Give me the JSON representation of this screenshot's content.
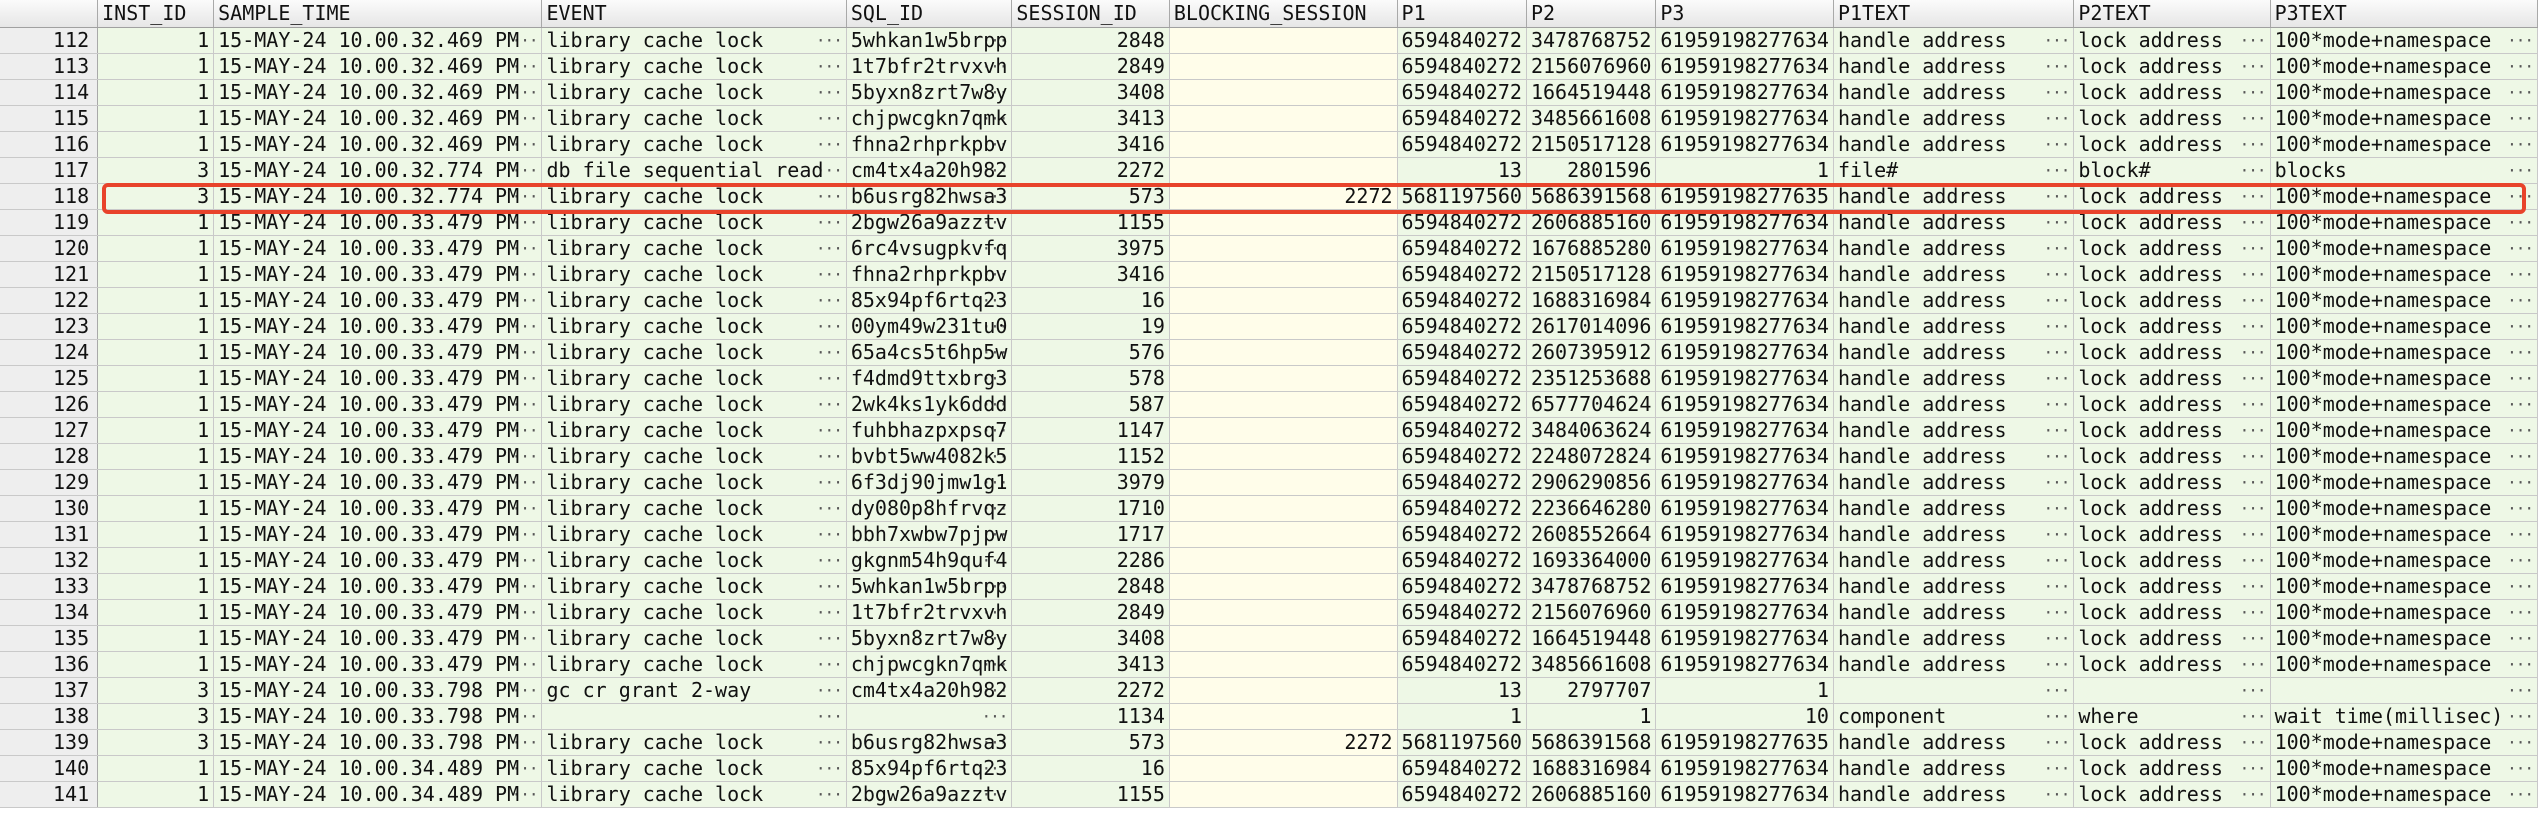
{
  "grid": {
    "columns": [
      {
        "key": "rownum",
        "label": ""
      },
      {
        "key": "inst_id",
        "label": "INST_ID"
      },
      {
        "key": "sample_time",
        "label": "SAMPLE_TIME"
      },
      {
        "key": "event",
        "label": "EVENT"
      },
      {
        "key": "sql_id",
        "label": "SQL_ID"
      },
      {
        "key": "session_id",
        "label": "SESSION_ID"
      },
      {
        "key": "blocking_session",
        "label": "BLOCKING_SESSION"
      },
      {
        "key": "p1",
        "label": "P1"
      },
      {
        "key": "p2",
        "label": "P2"
      },
      {
        "key": "p3",
        "label": "P3"
      },
      {
        "key": "p1text",
        "label": "P1TEXT"
      },
      {
        "key": "p2text",
        "label": "P2TEXT"
      },
      {
        "key": "p3text",
        "label": "P3TEXT"
      }
    ],
    "ellipsis_glyph": "···",
    "highlighted_row": "118",
    "rows": [
      [
        "112",
        "1",
        "15-MAY-24 10.00.32.469 PM",
        "library cache lock",
        "5whkan1w5brpp",
        "2848",
        "",
        "6594840272",
        "3478768752",
        "61959198277634",
        "handle address",
        "lock address",
        "100*mode+namespace"
      ],
      [
        "113",
        "1",
        "15-MAY-24 10.00.32.469 PM",
        "library cache lock",
        "1t7bfr2trvxvh",
        "2849",
        "",
        "6594840272",
        "2156076960",
        "61959198277634",
        "handle address",
        "lock address",
        "100*mode+namespace"
      ],
      [
        "114",
        "1",
        "15-MAY-24 10.00.32.469 PM",
        "library cache lock",
        "5byxn8zrt7w8y",
        "3408",
        "",
        "6594840272",
        "1664519448",
        "61959198277634",
        "handle address",
        "lock address",
        "100*mode+namespace"
      ],
      [
        "115",
        "1",
        "15-MAY-24 10.00.32.469 PM",
        "library cache lock",
        "chjpwcgkn7qmk",
        "3413",
        "",
        "6594840272",
        "3485661608",
        "61959198277634",
        "handle address",
        "lock address",
        "100*mode+namespace"
      ],
      [
        "116",
        "1",
        "15-MAY-24 10.00.32.469 PM",
        "library cache lock",
        "fhna2rhprkpbv",
        "3416",
        "",
        "6594840272",
        "2150517128",
        "61959198277634",
        "handle address",
        "lock address",
        "100*mode+namespace"
      ],
      [
        "117",
        "3",
        "15-MAY-24 10.00.32.774 PM",
        "db file sequential read",
        "cm4tx4a20h982",
        "2272",
        "",
        "13",
        "2801596",
        "1",
        "file#",
        "block#",
        "blocks"
      ],
      [
        "118",
        "3",
        "15-MAY-24 10.00.32.774 PM",
        "library cache lock",
        "b6usrg82hwsa3",
        "573",
        "2272",
        "5681197560",
        "5686391568",
        "61959198277635",
        "handle address",
        "lock address",
        "100*mode+namespace"
      ],
      [
        "119",
        "1",
        "15-MAY-24 10.00.33.479 PM",
        "library cache lock",
        "2bgw26a9azztv",
        "1155",
        "",
        "6594840272",
        "2606885160",
        "61959198277634",
        "handle address",
        "lock address",
        "100*mode+namespace"
      ],
      [
        "120",
        "1",
        "15-MAY-24 10.00.33.479 PM",
        "library cache lock",
        "6rc4vsugpkvfq",
        "3975",
        "",
        "6594840272",
        "1676885280",
        "61959198277634",
        "handle address",
        "lock address",
        "100*mode+namespace"
      ],
      [
        "121",
        "1",
        "15-MAY-24 10.00.33.479 PM",
        "library cache lock",
        "fhna2rhprkpbv",
        "3416",
        "",
        "6594840272",
        "2150517128",
        "61959198277634",
        "handle address",
        "lock address",
        "100*mode+namespace"
      ],
      [
        "122",
        "1",
        "15-MAY-24 10.00.33.479 PM",
        "library cache lock",
        "85x94pf6rtq23",
        "16",
        "",
        "6594840272",
        "1688316984",
        "61959198277634",
        "handle address",
        "lock address",
        "100*mode+namespace"
      ],
      [
        "123",
        "1",
        "15-MAY-24 10.00.33.479 PM",
        "library cache lock",
        "00ym49w231tu0",
        "19",
        "",
        "6594840272",
        "2617014096",
        "61959198277634",
        "handle address",
        "lock address",
        "100*mode+namespace"
      ],
      [
        "124",
        "1",
        "15-MAY-24 10.00.33.479 PM",
        "library cache lock",
        "65a4cs5t6hp5w",
        "576",
        "",
        "6594840272",
        "2607395912",
        "61959198277634",
        "handle address",
        "lock address",
        "100*mode+namespace"
      ],
      [
        "125",
        "1",
        "15-MAY-24 10.00.33.479 PM",
        "library cache lock",
        "f4dmd9ttxbrg3",
        "578",
        "",
        "6594840272",
        "2351253688",
        "61959198277634",
        "handle address",
        "lock address",
        "100*mode+namespace"
      ],
      [
        "126",
        "1",
        "15-MAY-24 10.00.33.479 PM",
        "library cache lock",
        "2wk4ks1yk6ddd",
        "587",
        "",
        "6594840272",
        "6577704624",
        "61959198277634",
        "handle address",
        "lock address",
        "100*mode+namespace"
      ],
      [
        "127",
        "1",
        "15-MAY-24 10.00.33.479 PM",
        "library cache lock",
        "fuhbhazpxpsq7",
        "1147",
        "",
        "6594840272",
        "3484063624",
        "61959198277634",
        "handle address",
        "lock address",
        "100*mode+namespace"
      ],
      [
        "128",
        "1",
        "15-MAY-24 10.00.33.479 PM",
        "library cache lock",
        "bvbt5ww4082k5",
        "1152",
        "",
        "6594840272",
        "2248072824",
        "61959198277634",
        "handle address",
        "lock address",
        "100*mode+namespace"
      ],
      [
        "129",
        "1",
        "15-MAY-24 10.00.33.479 PM",
        "library cache lock",
        "6f3dj90jmw1g1",
        "3979",
        "",
        "6594840272",
        "2906290856",
        "61959198277634",
        "handle address",
        "lock address",
        "100*mode+namespace"
      ],
      [
        "130",
        "1",
        "15-MAY-24 10.00.33.479 PM",
        "library cache lock",
        "dy080p8hfrvqz",
        "1710",
        "",
        "6594840272",
        "2236646280",
        "61959198277634",
        "handle address",
        "lock address",
        "100*mode+namespace"
      ],
      [
        "131",
        "1",
        "15-MAY-24 10.00.33.479 PM",
        "library cache lock",
        "bbh7xwbw7pjpw",
        "1717",
        "",
        "6594840272",
        "2608552664",
        "61959198277634",
        "handle address",
        "lock address",
        "100*mode+namespace"
      ],
      [
        "132",
        "1",
        "15-MAY-24 10.00.33.479 PM",
        "library cache lock",
        "gkgnm54h9quf4",
        "2286",
        "",
        "6594840272",
        "1693364000",
        "61959198277634",
        "handle address",
        "lock address",
        "100*mode+namespace"
      ],
      [
        "133",
        "1",
        "15-MAY-24 10.00.33.479 PM",
        "library cache lock",
        "5whkan1w5brpp",
        "2848",
        "",
        "6594840272",
        "3478768752",
        "61959198277634",
        "handle address",
        "lock address",
        "100*mode+namespace"
      ],
      [
        "134",
        "1",
        "15-MAY-24 10.00.33.479 PM",
        "library cache lock",
        "1t7bfr2trvxvh",
        "2849",
        "",
        "6594840272",
        "2156076960",
        "61959198277634",
        "handle address",
        "lock address",
        "100*mode+namespace"
      ],
      [
        "135",
        "1",
        "15-MAY-24 10.00.33.479 PM",
        "library cache lock",
        "5byxn8zrt7w8y",
        "3408",
        "",
        "6594840272",
        "1664519448",
        "61959198277634",
        "handle address",
        "lock address",
        "100*mode+namespace"
      ],
      [
        "136",
        "1",
        "15-MAY-24 10.00.33.479 PM",
        "library cache lock",
        "chjpwcgkn7qmk",
        "3413",
        "",
        "6594840272",
        "3485661608",
        "61959198277634",
        "handle address",
        "lock address",
        "100*mode+namespace"
      ],
      [
        "137",
        "3",
        "15-MAY-24 10.00.33.798 PM",
        "gc cr grant 2-way",
        "cm4tx4a20h982",
        "2272",
        "",
        "13",
        "2797707",
        "1",
        "",
        "",
        ""
      ],
      [
        "138",
        "3",
        "15-MAY-24 10.00.33.798 PM",
        "",
        "",
        "1134",
        "",
        "1",
        "1",
        "10",
        "component",
        "where",
        "wait time(millisec)"
      ],
      [
        "139",
        "3",
        "15-MAY-24 10.00.33.798 PM",
        "library cache lock",
        "b6usrg82hwsa3",
        "573",
        "2272",
        "5681197560",
        "5686391568",
        "61959198277635",
        "handle address",
        "lock address",
        "100*mode+namespace"
      ],
      [
        "140",
        "1",
        "15-MAY-24 10.00.34.489 PM",
        "library cache lock",
        "85x94pf6rtq23",
        "16",
        "",
        "6594840272",
        "1688316984",
        "61959198277634",
        "handle address",
        "lock address",
        "100*mode+namespace"
      ],
      [
        "141",
        "1",
        "15-MAY-24 10.00.34.489 PM",
        "library cache lock",
        "2bgw26a9azztv",
        "1155",
        "",
        "6594840272",
        "2606885160",
        "61959198277634",
        "handle address",
        "lock address",
        "100*mode+namespace"
      ]
    ]
  }
}
